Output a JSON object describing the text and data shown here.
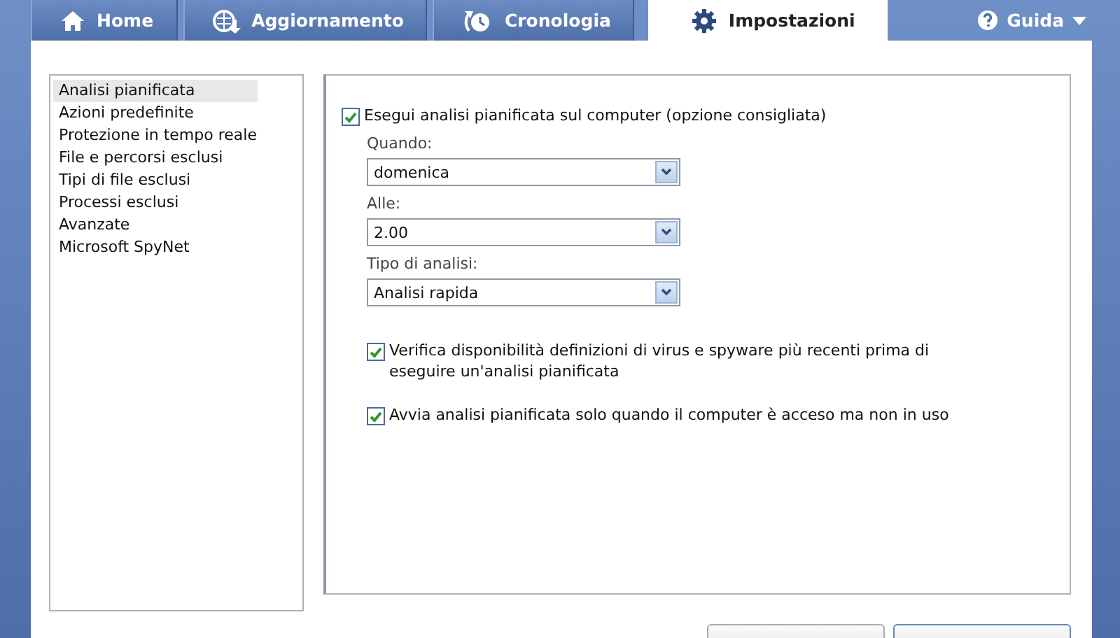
{
  "tabs": [
    {
      "label": "Home",
      "kind": "home",
      "selected": false
    },
    {
      "label": "Aggiornamento",
      "kind": "update",
      "selected": false
    },
    {
      "label": "Cronologia",
      "kind": "history",
      "selected": false
    },
    {
      "label": "Impostazioni",
      "kind": "settings",
      "selected": true
    }
  ],
  "help_menu": {
    "label": "Guida"
  },
  "sidebar": {
    "items": [
      {
        "label": "Analisi pianificata",
        "selected": true
      },
      {
        "label": "Azioni predefinite",
        "selected": false
      },
      {
        "label": "Protezione in tempo reale",
        "selected": false
      },
      {
        "label": "File e percorsi esclusi",
        "selected": false
      },
      {
        "label": "Tipi di file esclusi",
        "selected": false
      },
      {
        "label": "Processi esclusi",
        "selected": false
      },
      {
        "label": "Avanzate",
        "selected": false
      },
      {
        "label": "Microsoft SpyNet",
        "selected": false
      }
    ]
  },
  "settings": {
    "main_option": {
      "label": "Esegui analisi pianificata sul computer (opzione consigliata)",
      "checked": true
    },
    "fields": [
      {
        "label": "Quando:",
        "value": "domenica"
      },
      {
        "label": "Alle:",
        "value": "2.00"
      },
      {
        "label": "Tipo di analisi:",
        "value": "Analisi rapida"
      }
    ],
    "options": [
      {
        "label": "Verifica disponibilità definizioni di virus e spyware più recenti prima di eseguire un'analisi pianificata",
        "checked": true
      },
      {
        "label": "Avvia analisi pianificata solo quando il computer è acceso ma non in uso",
        "checked": true
      }
    ]
  },
  "footer_buttons": [
    {
      "kind": "button"
    },
    {
      "kind": "button"
    }
  ]
}
